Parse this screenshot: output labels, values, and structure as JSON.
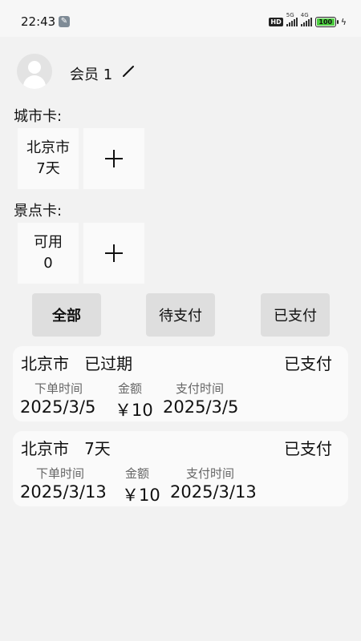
{
  "status_bar": {
    "time": "22:43",
    "hd": "HD",
    "net1": "5G",
    "net2": "4G",
    "battery": "100"
  },
  "profile": {
    "member_name": "会员 1"
  },
  "city_card": {
    "label": "城市卡:",
    "items": [
      {
        "line1": "北京市",
        "line2": "7天"
      }
    ]
  },
  "scenic_card": {
    "label": "景点卡:",
    "items": [
      {
        "line1": "可用",
        "line2": "0"
      }
    ]
  },
  "filters": {
    "all": "全部",
    "pending": "待支付",
    "paid": "已支付",
    "selected": "全部"
  },
  "orders": [
    {
      "title": "北京市   已过期",
      "status": "已支付",
      "order_time_label": "下单时间",
      "amount_label": "金额",
      "pay_time_label": "支付时间",
      "order_time": "2025/3/5",
      "amount": "￥10",
      "pay_time": "2025/3/5"
    },
    {
      "title": "北京市   7天",
      "status": "已支付",
      "order_time_label": "下单时间",
      "amount_label": "金额",
      "pay_time_label": "支付时间",
      "order_time": "2025/3/13",
      "amount": "￥10",
      "pay_time": "2025/3/13"
    }
  ]
}
